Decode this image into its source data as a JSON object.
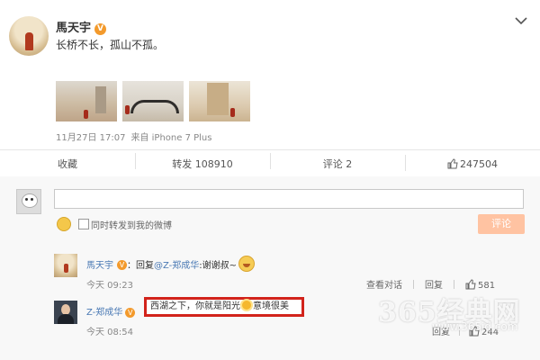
{
  "post": {
    "author": "馬天宇",
    "text": "长桥不长，孤山不孤。",
    "meta_time": "11月27日 17:07",
    "meta_source": "来自 iPhone 7 Plus",
    "photos": [
      "photo-1",
      "photo-2",
      "photo-3"
    ]
  },
  "actions": {
    "collect": "收藏",
    "repost": "转发 108910",
    "comment": "评论 2",
    "like": "247504"
  },
  "composer": {
    "forward_checkbox_label": "同时转发到我的微博",
    "submit_label": "评论"
  },
  "comments": [
    {
      "author": "馬天宇",
      "reply_prefix": "：回复",
      "mention": "@Z-郑成华",
      "body": ":谢谢叔~",
      "time": "今天 09:23",
      "action_view": "查看对话",
      "action_reply": "回复",
      "likes": "581"
    },
    {
      "author": "Z-郑成华",
      "body_a": "西湖之下，你就是阳光",
      "body_b": "意境很美",
      "time": "今天 08:54",
      "action_reply": "回复",
      "likes": "244"
    }
  ],
  "watermark": {
    "main": "365经典网",
    "sub": "www.365jd.com"
  },
  "colors": {
    "link": "#4a79b4",
    "highlight_border": "#d2231b",
    "submit_bg": "#ffc3a2",
    "badge": "#f39a2c"
  }
}
